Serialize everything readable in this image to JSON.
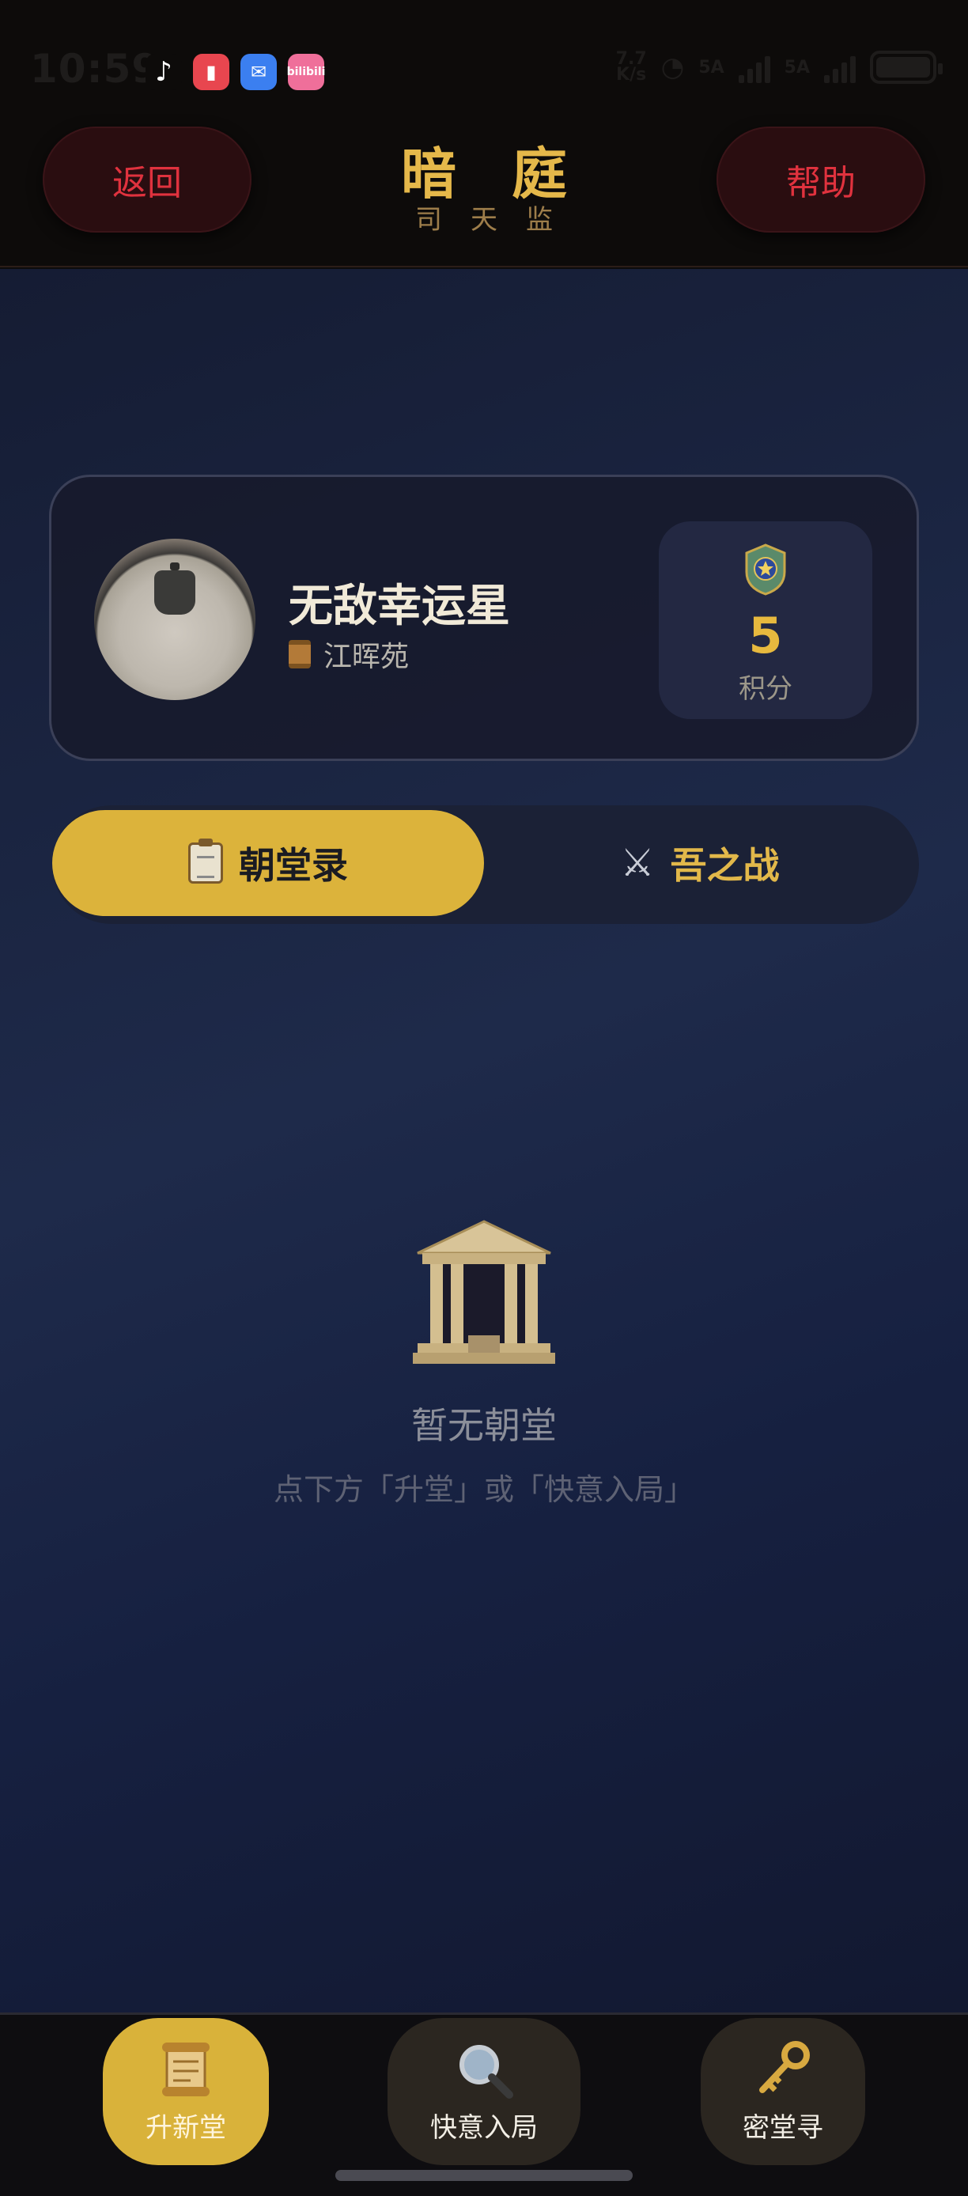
{
  "status_bar": {
    "time": "10:59",
    "app_icons": [
      "tiktok-icon",
      "book-icon",
      "mail-icon",
      "bilibili-icon"
    ],
    "bili_label": "bilibili",
    "network_speed": "7.7\nK/s",
    "sim1_label": "5A",
    "sim2_label": "5A"
  },
  "header": {
    "back_label": "返回",
    "title": "暗庭",
    "subtitle": "司天监",
    "help_label": "帮助"
  },
  "profile": {
    "name": "无敌幸运星",
    "org": "江晖苑",
    "score": "5",
    "score_label": "积分"
  },
  "tabs": [
    {
      "label": "朝堂录",
      "icon": "clipboard-icon",
      "active": true
    },
    {
      "label": "吾之战",
      "icon": "crossed-swords-icon",
      "active": false
    }
  ],
  "empty_state": {
    "icon": "temple-icon",
    "title": "暂无朝堂",
    "hint": "点下方「升堂」或「快意入局」"
  },
  "bottom_nav": [
    {
      "label": "升新堂",
      "icon": "scroll-icon",
      "active": true
    },
    {
      "label": "快意入局",
      "icon": "magnifier-icon",
      "active": false
    },
    {
      "label": "密堂寻",
      "icon": "key-icon",
      "active": false
    }
  ],
  "colors": {
    "gold": "#dcb33b",
    "danger_red": "#e0323e",
    "background_navy": "#1e2a4a"
  }
}
